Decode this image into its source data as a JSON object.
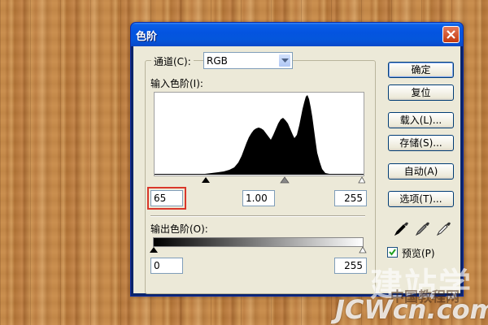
{
  "dialog": {
    "title": "色阶",
    "channel_label": "通道(C):",
    "channel_value": "RGB",
    "input_levels_label": "输入色阶(I):",
    "input_black": "65",
    "input_gamma": "1.00",
    "input_white": "255",
    "output_levels_label": "输出色阶(O):",
    "output_black": "0",
    "output_white": "255"
  },
  "buttons": {
    "ok": "确定",
    "reset": "复位",
    "load": "载入(L)...",
    "save": "存储(S)...",
    "auto": "自动(A)",
    "options": "选项(T)..."
  },
  "preview": {
    "label": "预览(P)",
    "checked": true
  },
  "icons": [
    "close-icon",
    "dropdown-arrow-icon",
    "black-eyedropper-icon",
    "gray-eyedropper-icon",
    "white-eyedropper-icon",
    "checkmark-icon"
  ],
  "watermark": {
    "top": "建站学",
    "middle": "中国教程网",
    "bottom": "JCWcn.com"
  },
  "colors": {
    "titlebar": "#0454e0",
    "dialog_bg": "#ece9d8",
    "highlight_box": "#d9372a"
  }
}
